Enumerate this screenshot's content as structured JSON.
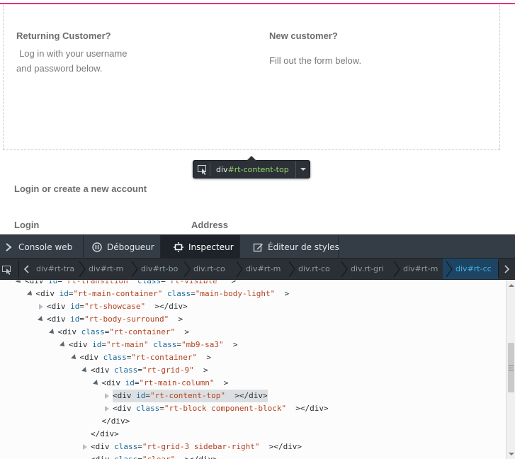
{
  "page": {
    "returning_title": "Returning Customer?",
    "returning_text_1": "Log in with your username",
    "returning_text_2": "and password below.",
    "new_title": "New customer?",
    "new_text": "Fill out the form below.",
    "login_section_title": "Login or create a new account",
    "login_label": "Login",
    "address_label": "Address"
  },
  "node_popup": {
    "element": "div",
    "id": "#rt-content-top"
  },
  "toolbar": {
    "tabs": [
      {
        "label": "Console web",
        "icon": "console-icon"
      },
      {
        "label": "Débogueur",
        "icon": "debugger-icon"
      },
      {
        "label": "Inspecteur",
        "icon": "inspector-icon",
        "active": true
      },
      {
        "label": "Éditeur de styles",
        "icon": "style-editor-icon"
      }
    ]
  },
  "breadcrumbs": [
    {
      "tag": "div",
      "sel": "#rt-tra"
    },
    {
      "tag": "div",
      "sel": "#rt-m"
    },
    {
      "tag": "div",
      "sel": "#rt-bo"
    },
    {
      "tag": "div",
      "sel": ".rt-co"
    },
    {
      "tag": "div",
      "sel": "#rt-m"
    },
    {
      "tag": "div",
      "sel": ".rt-co"
    },
    {
      "tag": "div",
      "sel": ".rt-gri"
    },
    {
      "tag": "div",
      "sel": "#rt-m"
    },
    {
      "tag": "div",
      "sel": "#rt-cc"
    }
  ],
  "markup": [
    {
      "indent": 0,
      "tw": "open",
      "tag": "div",
      "attrs": [
        [
          "id",
          "rt-transition"
        ],
        [
          "class",
          "rt-visible"
        ]
      ],
      "tail": ">"
    },
    {
      "indent": 1,
      "tw": "open",
      "tag": "div",
      "attrs": [
        [
          "id",
          "rt-main-container"
        ],
        [
          "class",
          "main-body-light"
        ]
      ],
      "tail": ">"
    },
    {
      "indent": 2,
      "tw": "closed",
      "tag": "div",
      "attrs": [
        [
          "id",
          "rt-showcase"
        ]
      ],
      "tail": "></div>"
    },
    {
      "indent": 2,
      "tw": "open",
      "tag": "div",
      "attrs": [
        [
          "id",
          "rt-body-surround"
        ]
      ],
      "tail": ">"
    },
    {
      "indent": 3,
      "tw": "open",
      "tag": "div",
      "attrs": [
        [
          "class",
          "rt-container"
        ]
      ],
      "tail": ">"
    },
    {
      "indent": 4,
      "tw": "open",
      "tag": "div",
      "attrs": [
        [
          "id",
          "rt-main"
        ],
        [
          "class",
          "mb9-sa3"
        ]
      ],
      "tail": ">"
    },
    {
      "indent": 5,
      "tw": "open",
      "tag": "div",
      "attrs": [
        [
          "class",
          "rt-container"
        ]
      ],
      "tail": ">"
    },
    {
      "indent": 6,
      "tw": "open",
      "tag": "div",
      "attrs": [
        [
          "class",
          "rt-grid-9"
        ]
      ],
      "tail": ">"
    },
    {
      "indent": 7,
      "tw": "open",
      "tag": "div",
      "attrs": [
        [
          "id",
          "rt-main-column"
        ]
      ],
      "tail": ">"
    },
    {
      "indent": 8,
      "tw": "closed",
      "tag": "div",
      "attrs": [
        [
          "id",
          "rt-content-top"
        ]
      ],
      "tail": "></div>",
      "highlight": true
    },
    {
      "indent": 8,
      "tw": "closed",
      "tag": "div",
      "attrs": [
        [
          "class",
          "rt-block component-block"
        ]
      ],
      "tail": "></div>"
    },
    {
      "indent": 7,
      "tw": "none",
      "close": "</div>"
    },
    {
      "indent": 6,
      "tw": "none",
      "close": "</div>"
    },
    {
      "indent": 6,
      "tw": "closed",
      "tag": "div",
      "attrs": [
        [
          "class",
          "rt-grid-3 sidebar-right"
        ]
      ],
      "tail": "></div>"
    },
    {
      "indent": 6,
      "tw": "none",
      "tag": "div",
      "attrs": [
        [
          "class",
          "clear"
        ]
      ],
      "tail": "></div>"
    }
  ]
}
